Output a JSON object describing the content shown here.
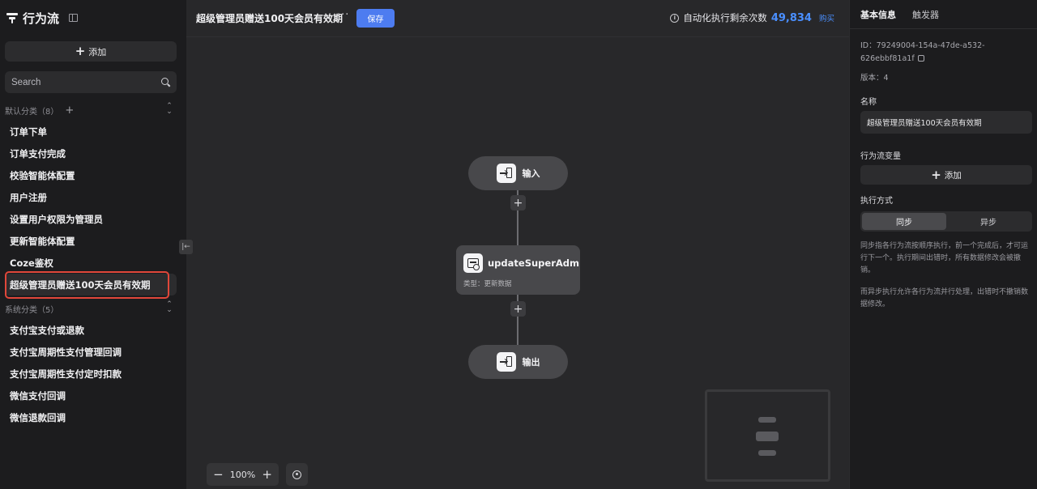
{
  "sidebar": {
    "title": "行为流",
    "add_label": "添加",
    "search_placeholder": "Search",
    "groups": [
      {
        "label": "默认分类（8）",
        "items": [
          "订单下单",
          "订单支付完成",
          "校验智能体配置",
          "用户注册",
          "设置用户权限为管理员",
          "更新智能体配置",
          "Coze鉴权",
          "超级管理员赠送100天会员有效期"
        ]
      },
      {
        "label": "系统分类（5）",
        "items": [
          "支付宝支付或退款",
          "支付宝周期性支付管理回调",
          "支付宝周期性支付定时扣款",
          "微信支付回调",
          "微信退款回调"
        ]
      }
    ]
  },
  "toolbar": {
    "flow_title": "超级管理员赠送100天会员有效期",
    "more_label": "···",
    "save_label": "保存",
    "quota_label": "自动化执行剩余次数",
    "quota_value": "49,834",
    "buy_label": "购买"
  },
  "canvas": {
    "input_node": "输入",
    "output_node": "输出",
    "action_node": {
      "title": "updateSuperAdm",
      "type": "类型：更新数据"
    },
    "zoom_level": "100%"
  },
  "panel": {
    "tabs": [
      "基本信息",
      "触发器"
    ],
    "id_line1": "ID：79249004-154a-47de-a532-",
    "id_line2": "626ebbf81a1f",
    "version": "版本：4",
    "name_label": "名称",
    "name_value": "超级管理员赠送100天会员有效期",
    "vars_label": "行为流变量",
    "vars_add": "添加",
    "mode_label": "执行方式",
    "mode_options": [
      "同步",
      "异步"
    ],
    "desc_sync": "同步指各行为流按顺序执行，前一个完成后，才可运行下一个。执行期间出错时，所有数据修改会被撤销。",
    "desc_async": "而异步执行允许各行为流并行处理，出错时不撤销数据修改。"
  },
  "colors": {
    "accent": "#4d7cf0",
    "highlight_border": "#e0473a",
    "quota_number": "#4a8fff"
  }
}
